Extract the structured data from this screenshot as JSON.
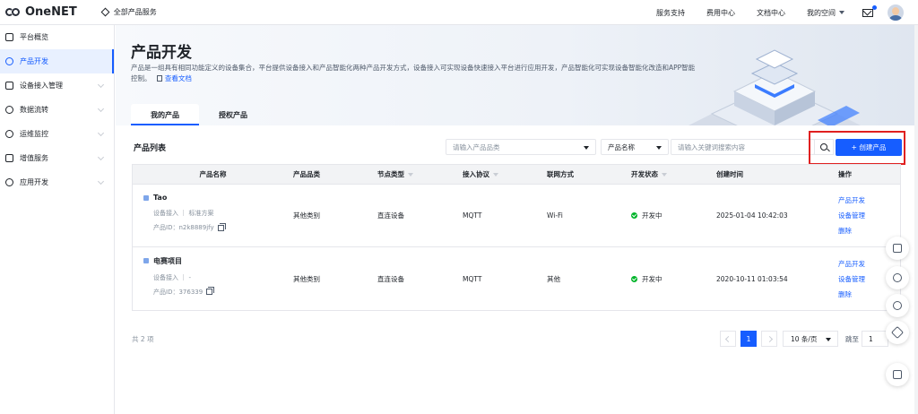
{
  "app": {
    "logo": "OneNET",
    "all_services": "全部产品服务"
  },
  "topnav": {
    "links": [
      "服务支持",
      "费用中心",
      "文档中心"
    ],
    "space": "我的空间"
  },
  "sidebar": {
    "items": [
      {
        "label": "平台概览",
        "icon": "overview-icon",
        "active": false
      },
      {
        "label": "产品开发",
        "icon": "product-icon",
        "active": true
      },
      {
        "label": "设备接入管理",
        "icon": "device-icon",
        "active": false
      },
      {
        "label": "数据流转",
        "icon": "dataflow-icon",
        "active": false
      },
      {
        "label": "运维监控",
        "icon": "monitor-icon",
        "active": false
      },
      {
        "label": "增值服务",
        "icon": "value-icon",
        "active": false
      },
      {
        "label": "应用开发",
        "icon": "app-icon",
        "active": false
      }
    ]
  },
  "hero": {
    "title": "产品开发",
    "desc": "产品是一组具有相同功能定义的设备集合，平台提供设备接入和产品智能化两种产品开发方式，设备接入可实现设备快速接入平台进行应用开发，产品智能化可实现设备智能化改造和APP智能控制。",
    "doc_link": "查看文档"
  },
  "tabs": [
    "我的产品",
    "授权产品"
  ],
  "list": {
    "title": "产品列表",
    "category_placeholder": "请输入产品品类",
    "field_select": "产品名称",
    "keyword_placeholder": "请输入关键词搜索内容",
    "create_button": "+ 创建产品"
  },
  "table": {
    "headers": [
      "产品名称",
      "产品品类",
      "节点类型",
      "接入协议",
      "联网方式",
      "开发状态",
      "创建时间",
      "操作"
    ],
    "rows": [
      {
        "name": "Tao",
        "sub": "设备接入 ｜ 标准方案",
        "pid": "产品ID：n2k8889jfy",
        "category": "其他类别",
        "node": "直连设备",
        "protocol": "MQTT",
        "network": "Wi-Fi",
        "status": "开发中",
        "created": "2025-01-04 10:42:03",
        "ops": [
          "产品开发",
          "设备管理",
          "删除"
        ]
      },
      {
        "name": "电赛项目",
        "sub": "设备接入 ｜ -",
        "pid": "产品ID：376339",
        "category": "其他类别",
        "node": "直连设备",
        "protocol": "MQTT",
        "network": "其他",
        "status": "开发中",
        "created": "2020-10-11 01:03:54",
        "ops": [
          "产品开发",
          "设备管理",
          "删除"
        ]
      }
    ]
  },
  "pagination": {
    "total": "共 2 项",
    "current": "1",
    "page_size": "10 条/页",
    "jump_label": "跳至",
    "jump_value": "1"
  },
  "colors": {
    "primary": "#165dff",
    "highlight": "#e02020",
    "status_ok": "#00b42a"
  }
}
